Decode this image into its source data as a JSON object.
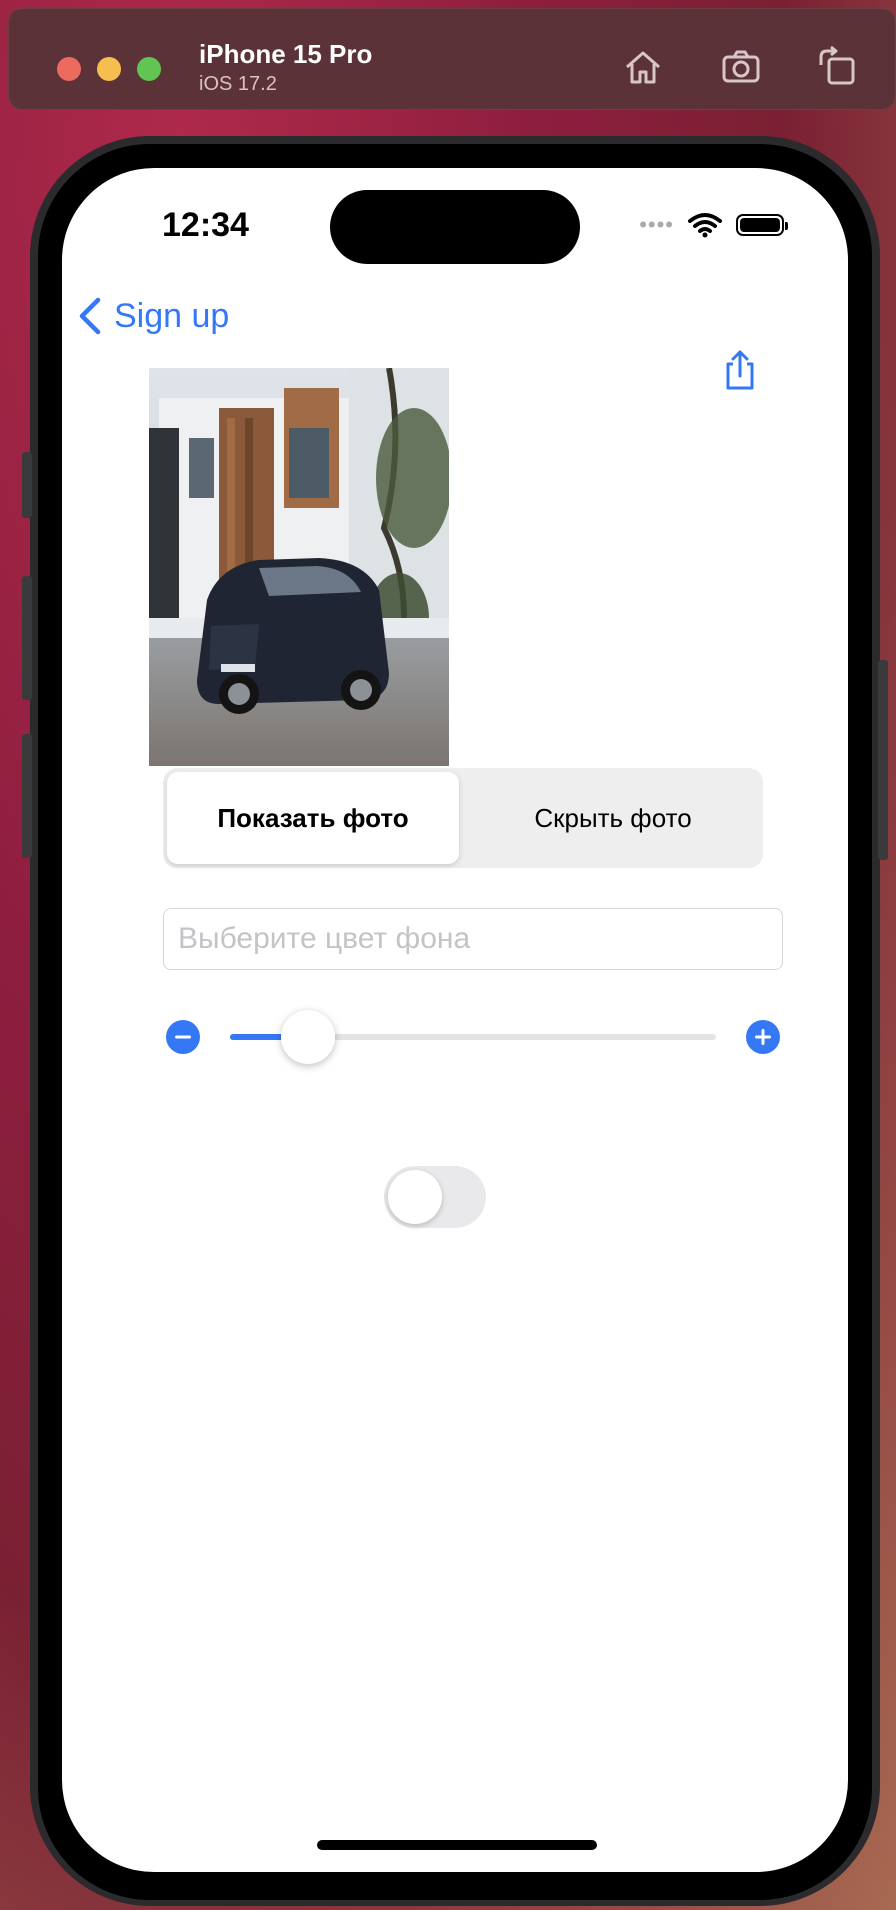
{
  "simulator": {
    "device_name": "iPhone 15 Pro",
    "os_version": "iOS 17.2",
    "toolbar_icons": [
      "home-icon",
      "screenshot-icon",
      "rotate-icon"
    ]
  },
  "status_bar": {
    "time": "12:34",
    "cellular_dots": "••••"
  },
  "nav": {
    "back_label": "Sign up"
  },
  "segmented_control": {
    "options": [
      "Показать фото",
      "Скрыть фото"
    ],
    "selected_index": 0
  },
  "color_input": {
    "placeholder": "Выберите цвет фона",
    "value": ""
  },
  "slider": {
    "value": 0.16
  },
  "toggle": {
    "on": false
  },
  "colors": {
    "accent": "#3478f6",
    "segment_bg": "#eeeeef",
    "toggle_off": "#e9e9eb"
  }
}
